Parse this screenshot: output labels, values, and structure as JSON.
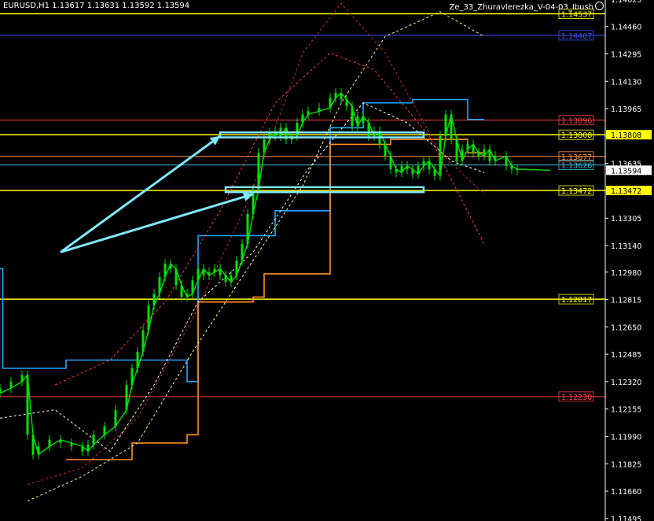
{
  "header": {
    "symbol_info": "EURUSD,H1  1.13617 1.13631 1.13592 1.13594",
    "indicator_name": "Ze_33_Zhuravlerezka_V-04-03_Ibush"
  },
  "colors": {
    "background": "#000000",
    "candle": "#00e000",
    "axis_text": "#ffffff",
    "arrow": "#7fe8ff"
  },
  "chart_data": {
    "type": "line",
    "symbol": "EURUSD",
    "timeframe": "H1",
    "price_ylim": [
      1.1148,
      1.1462
    ],
    "yticks": [
      1.14625,
      1.1446,
      1.14295,
      1.1413,
      1.13965,
      1.138,
      1.13635,
      1.1347,
      1.13305,
      1.1314,
      1.1298,
      1.12815,
      1.1265,
      1.12485,
      1.1232,
      1.12155,
      1.1199,
      1.11825,
      1.1166,
      1.11495
    ],
    "ytick_labels": [
      "1.14625",
      "1.14460",
      "1.14295",
      "1.14130",
      "1.13965",
      "1.13800",
      "1.13635",
      "1.13470",
      "1.13305",
      "1.13140",
      "1.12980",
      "1.12815",
      "1.12650",
      "1.12485",
      "1.12320",
      "1.12155",
      "1.11990",
      "1.11825",
      "1.11660",
      "1.11495"
    ],
    "current_price": {
      "value": 1.13594,
      "label": "1.13594"
    },
    "levels": [
      {
        "value": 1.14537,
        "label": "1.14537",
        "color": "#ffff00"
      },
      {
        "value": 1.14407,
        "label": "1.14407",
        "color": "#3a50ff"
      },
      {
        "value": 1.13896,
        "label": "1.13896",
        "color": "#ff4040"
      },
      {
        "value": 1.13808,
        "label": "1.13808",
        "color": "#ffff00"
      },
      {
        "value": 1.13677,
        "label": "1.13677",
        "color": "#ff9040"
      },
      {
        "value": 1.13626,
        "label": "1.13626",
        "color": "#40c0e0"
      },
      {
        "value": 1.13472,
        "label": "1.13472",
        "color": "#ffff00"
      },
      {
        "value": 1.12817,
        "label": "1.12817",
        "color": "#ffff00"
      },
      {
        "value": 1.1223,
        "label": "1.12230",
        "color": "#ff4040"
      }
    ],
    "price_path": [
      [
        0,
        1.1225
      ],
      [
        0.02,
        1.1228
      ],
      [
        0.04,
        1.1232
      ],
      [
        0.05,
        1.1236
      ],
      [
        0.06,
        1.12
      ],
      [
        0.07,
        1.1188
      ],
      [
        0.09,
        1.1193
      ],
      [
        0.11,
        1.1197
      ],
      [
        0.13,
        1.1195
      ],
      [
        0.15,
        1.1193
      ],
      [
        0.16,
        1.119
      ],
      [
        0.17,
        1.1194
      ],
      [
        0.19,
        1.12
      ],
      [
        0.21,
        1.1205
      ],
      [
        0.23,
        1.1215
      ],
      [
        0.24,
        1.123
      ],
      [
        0.25,
        1.124
      ],
      [
        0.26,
        1.125
      ],
      [
        0.27,
        1.1263
      ],
      [
        0.28,
        1.1278
      ],
      [
        0.29,
        1.1285
      ],
      [
        0.3,
        1.1295
      ],
      [
        0.31,
        1.1303
      ],
      [
        0.32,
        1.13
      ],
      [
        0.33,
        1.129
      ],
      [
        0.34,
        1.1283
      ],
      [
        0.35,
        1.1285
      ],
      [
        0.36,
        1.1293
      ],
      [
        0.37,
        1.13
      ],
      [
        0.38,
        1.1296
      ],
      [
        0.39,
        1.1298
      ],
      [
        0.4,
        1.13
      ],
      [
        0.41,
        1.1296
      ],
      [
        0.42,
        1.1292
      ],
      [
        0.43,
        1.1296
      ],
      [
        0.44,
        1.1305
      ],
      [
        0.45,
        1.1315
      ],
      [
        0.46,
        1.1333
      ],
      [
        0.47,
        1.1348
      ],
      [
        0.48,
        1.137
      ],
      [
        0.49,
        1.1378
      ],
      [
        0.5,
        1.1382
      ],
      [
        0.51,
        1.138
      ],
      [
        0.52,
        1.1385
      ],
      [
        0.53,
        1.1378
      ],
      [
        0.54,
        1.138
      ],
      [
        0.55,
        1.1388
      ],
      [
        0.56,
        1.1393
      ],
      [
        0.58,
        1.1395
      ],
      [
        0.6,
        1.1397
      ],
      [
        0.61,
        1.1403
      ],
      [
        0.62,
        1.1406
      ],
      [
        0.63,
        1.1402
      ],
      [
        0.64,
        1.1398
      ],
      [
        0.65,
        1.1386
      ],
      [
        0.66,
        1.1392
      ],
      [
        0.67,
        1.1388
      ],
      [
        0.68,
        1.138
      ],
      [
        0.69,
        1.1383
      ],
      [
        0.7,
        1.1375
      ],
      [
        0.71,
        1.1368
      ],
      [
        0.72,
        1.136
      ],
      [
        0.73,
        1.1358
      ],
      [
        0.74,
        1.1362
      ],
      [
        0.75,
        1.136
      ],
      [
        0.76,
        1.1357
      ],
      [
        0.77,
        1.1362
      ],
      [
        0.78,
        1.1365
      ],
      [
        0.79,
        1.136
      ],
      [
        0.8,
        1.1356
      ],
      [
        0.81,
        1.138
      ],
      [
        0.82,
        1.1393
      ],
      [
        0.83,
        1.1378
      ],
      [
        0.84,
        1.1365
      ],
      [
        0.85,
        1.1372
      ],
      [
        0.86,
        1.1375
      ],
      [
        0.87,
        1.137
      ],
      [
        0.88,
        1.1368
      ],
      [
        0.89,
        1.1372
      ],
      [
        0.9,
        1.1365
      ],
      [
        0.92,
        1.1368
      ],
      [
        0.93,
        1.1362
      ],
      [
        0.94,
        1.136
      ],
      [
        1.0,
        1.13594
      ]
    ],
    "overlay_lines": [
      {
        "color": "#20a8ff",
        "path": [
          [
            0,
            1.13
          ],
          [
            0.005,
            1.13
          ],
          [
            0.005,
            1.124
          ],
          [
            0.12,
            1.124
          ],
          [
            0.12,
            1.1245
          ],
          [
            0.34,
            1.1245
          ],
          [
            0.34,
            1.1232
          ],
          [
            0.36,
            1.1232
          ],
          [
            0.36,
            1.132
          ],
          [
            0.5,
            1.132
          ],
          [
            0.5,
            1.1335
          ],
          [
            0.6,
            1.1335
          ],
          [
            0.6,
            1.1385
          ],
          [
            0.66,
            1.1385
          ],
          [
            0.66,
            1.14
          ],
          [
            0.75,
            1.14
          ],
          [
            0.75,
            1.1402
          ],
          [
            0.81,
            1.1402
          ],
          [
            0.81,
            1.1402
          ],
          [
            0.85,
            1.1402
          ],
          [
            0.85,
            1.139
          ],
          [
            0.88,
            1.139
          ]
        ]
      },
      {
        "color": "#ff9020",
        "path": [
          [
            0.12,
            1.1185
          ],
          [
            0.24,
            1.1185
          ],
          [
            0.24,
            1.1195
          ],
          [
            0.34,
            1.1195
          ],
          [
            0.34,
            1.12
          ],
          [
            0.36,
            1.12
          ],
          [
            0.36,
            1.128
          ],
          [
            0.46,
            1.128
          ],
          [
            0.46,
            1.1283
          ],
          [
            0.48,
            1.1283
          ],
          [
            0.48,
            1.1297
          ],
          [
            0.6,
            1.1297
          ],
          [
            0.6,
            1.1375
          ],
          [
            0.71,
            1.1375
          ],
          [
            0.71,
            1.1378
          ],
          [
            0.85,
            1.1378
          ],
          [
            0.85,
            1.137
          ],
          [
            0.88,
            1.137
          ]
        ]
      },
      {
        "color": "#ffffff",
        "path": [
          [
            0,
            1.121
          ],
          [
            0.1,
            1.1215
          ],
          [
            0.2,
            1.119
          ],
          [
            0.28,
            1.123
          ],
          [
            0.36,
            1.128
          ],
          [
            0.46,
            1.131
          ],
          [
            0.56,
            1.136
          ],
          [
            0.66,
            1.14
          ],
          [
            0.74,
            1.1388
          ],
          [
            0.82,
            1.1365
          ],
          [
            0.88,
            1.1358
          ]
        ]
      },
      {
        "color": "#ffff80",
        "path": [
          [
            0.05,
            1.116
          ],
          [
            0.15,
            1.1175
          ],
          [
            0.25,
            1.1195
          ],
          [
            0.35,
            1.125
          ],
          [
            0.45,
            1.13
          ],
          [
            0.55,
            1.135
          ],
          [
            0.62,
            1.14
          ],
          [
            0.7,
            1.144
          ],
          [
            0.8,
            1.1455
          ],
          [
            0.88,
            1.144
          ]
        ]
      },
      {
        "color": "#ff4040",
        "path": [
          [
            0.1,
            1.123
          ],
          [
            0.2,
            1.1245
          ],
          [
            0.3,
            1.128
          ],
          [
            0.4,
            1.1335
          ],
          [
            0.5,
            1.14
          ],
          [
            0.6,
            1.143
          ],
          [
            0.68,
            1.142
          ],
          [
            0.78,
            1.138
          ],
          [
            0.88,
            1.1315
          ]
        ]
      },
      {
        "color": "#c03030",
        "path": [
          [
            0.05,
            1.117
          ],
          [
            0.15,
            1.118
          ],
          [
            0.25,
            1.121
          ],
          [
            0.35,
            1.127
          ],
          [
            0.45,
            1.134
          ],
          [
            0.55,
            1.143
          ],
          [
            0.62,
            1.146
          ],
          [
            0.7,
            1.143
          ],
          [
            0.8,
            1.137
          ],
          [
            0.88,
            1.1345
          ]
        ]
      }
    ],
    "zones": [
      {
        "x_range": [
          0.4,
          0.77
        ],
        "y_range": [
          1.13792,
          1.13822
        ],
        "color": "#7fe8ff"
      },
      {
        "x_range": [
          0.41,
          0.77
        ],
        "y_range": [
          1.13462,
          1.13492
        ],
        "color": "#7fe8ff"
      }
    ],
    "arrows": [
      {
        "from": [
          0.11,
          1.131
        ],
        "to": [
          0.4,
          1.138
        ],
        "color": "#7fe8ff"
      },
      {
        "from": [
          0.11,
          1.131
        ],
        "to": [
          0.46,
          1.1345
        ],
        "color": "#7fe8ff"
      }
    ]
  }
}
